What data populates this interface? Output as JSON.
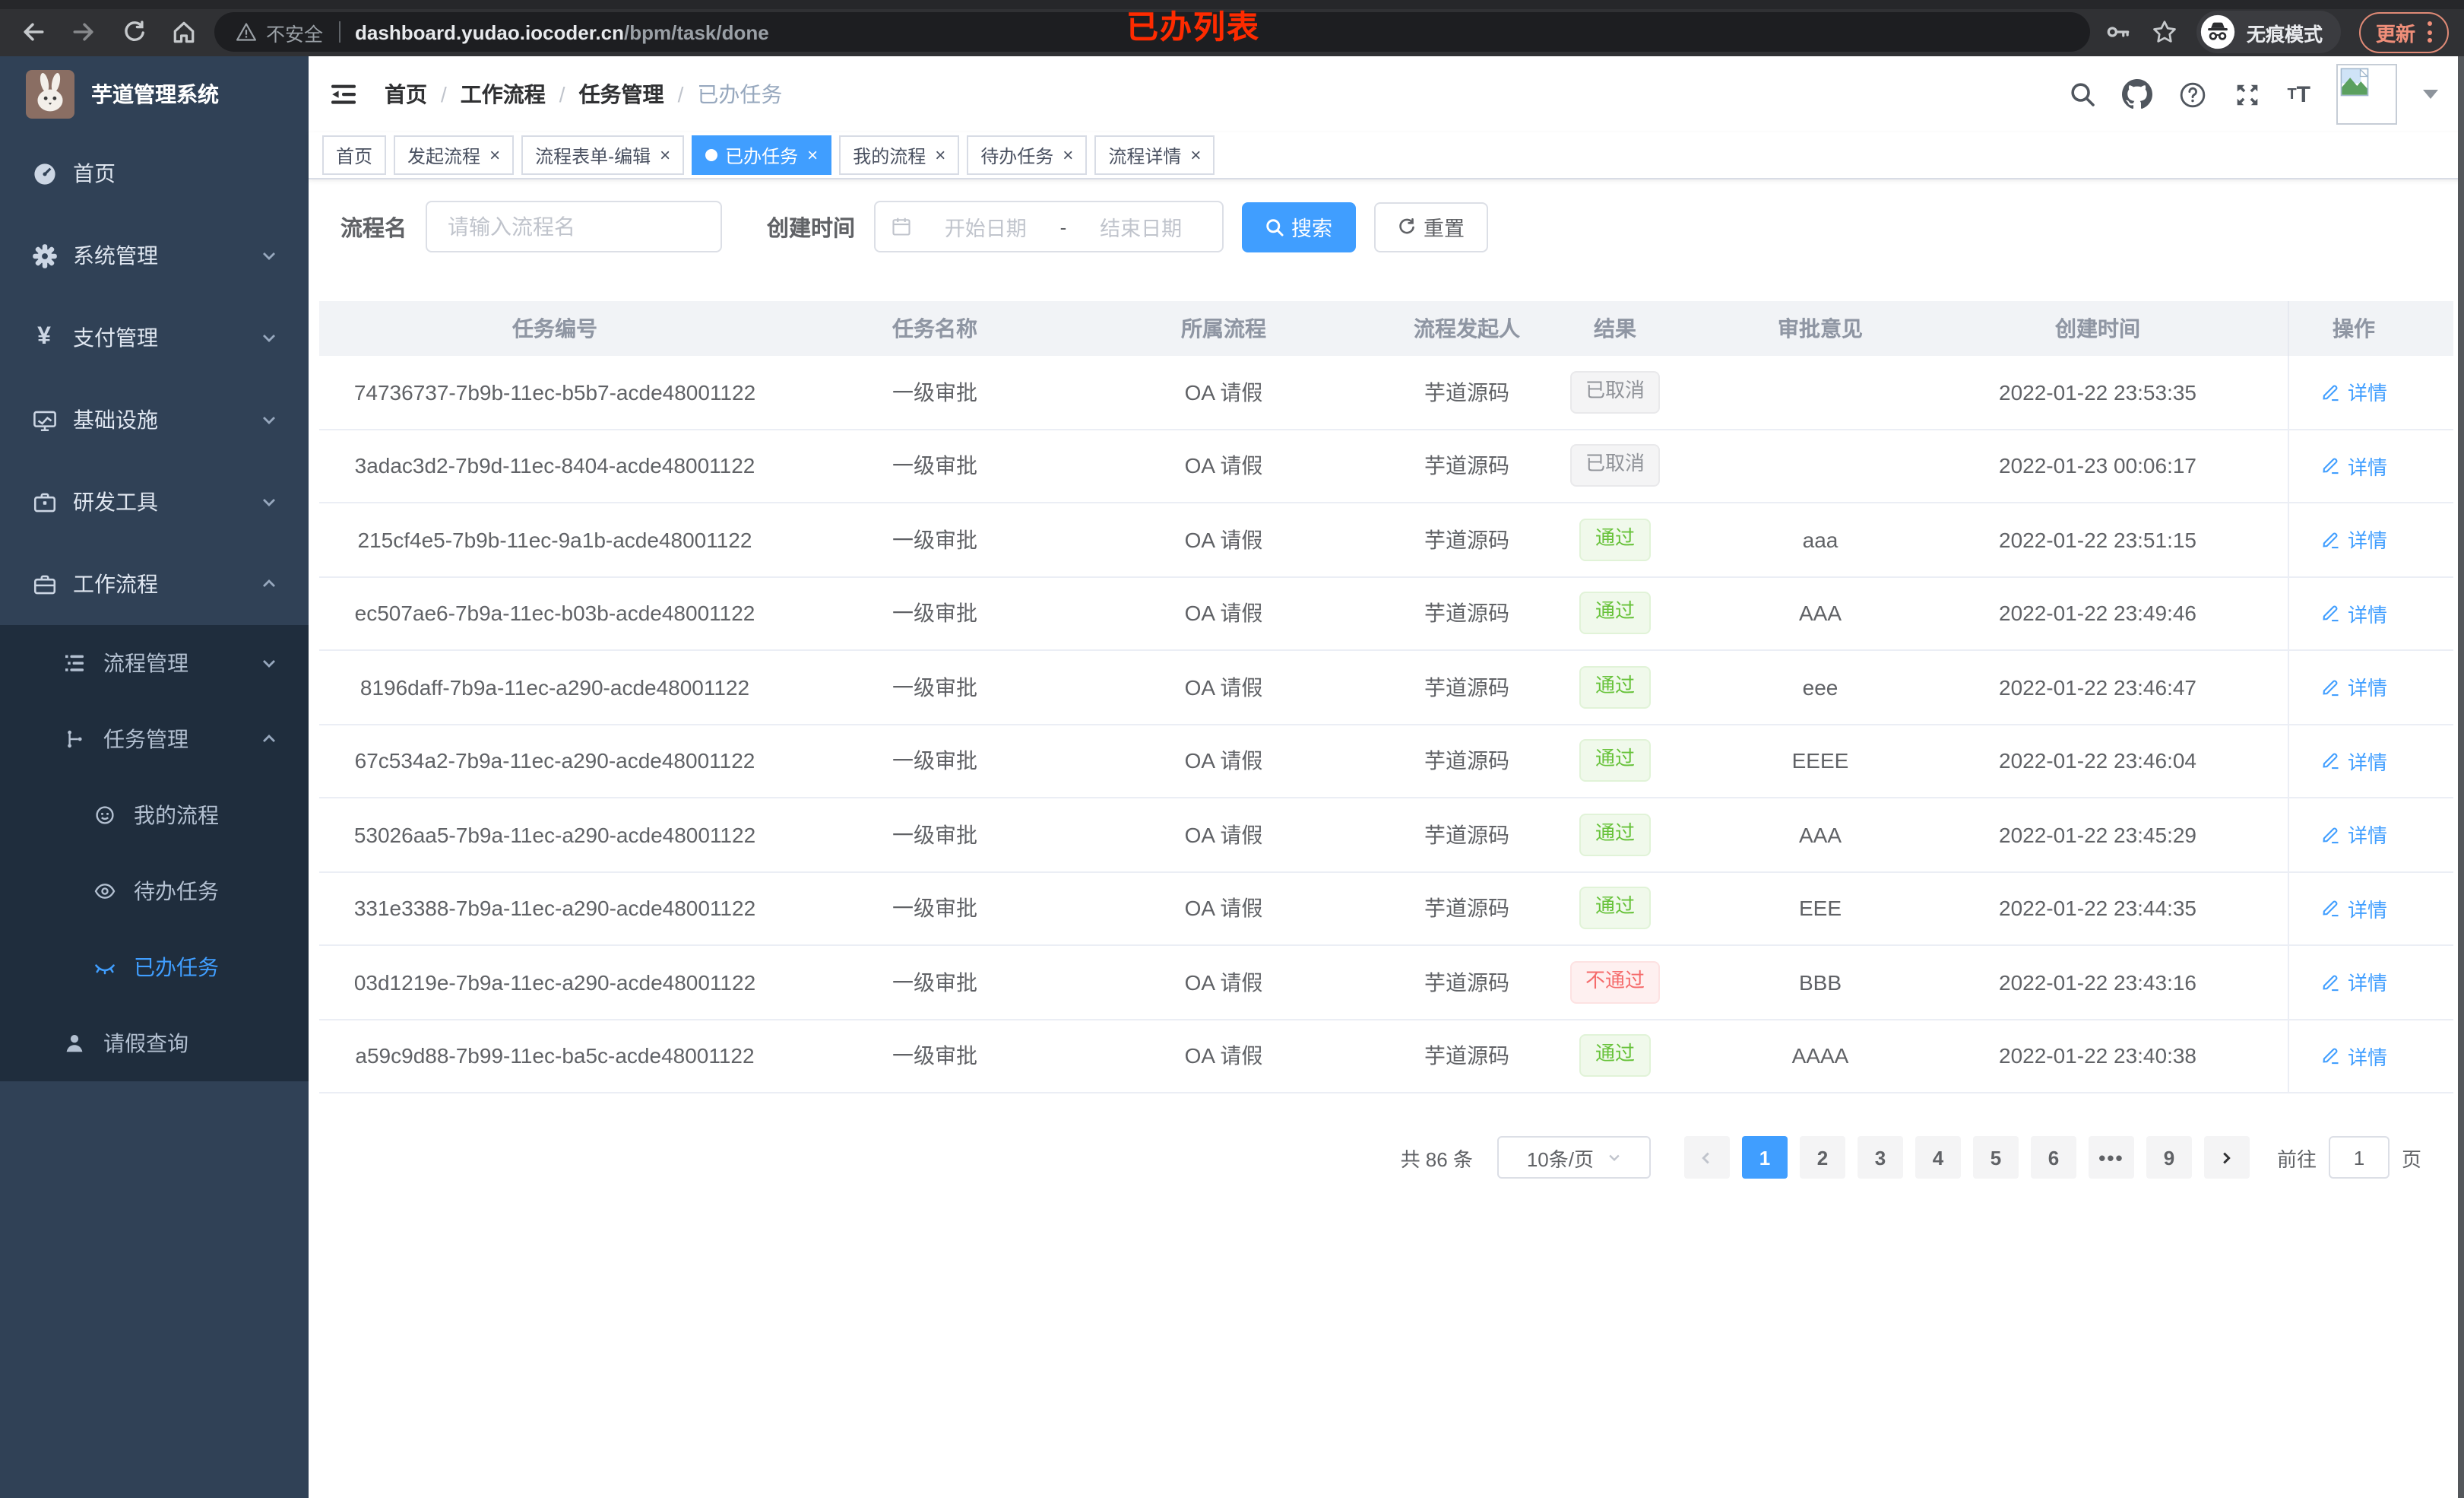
{
  "annotation": "已办列表",
  "browser": {
    "security_label": "不安全",
    "url_host": "dashboard.yudao.iocoder.cn",
    "url_path": "/bpm/task/done",
    "incognito_label": "无痕模式",
    "update_label": "更新"
  },
  "sidebar": {
    "app_title": "芋道管理系统",
    "items": [
      {
        "label": "首页"
      },
      {
        "label": "系统管理"
      },
      {
        "label": "支付管理"
      },
      {
        "label": "基础设施"
      },
      {
        "label": "研发工具"
      },
      {
        "label": "工作流程"
      },
      {
        "label": "流程管理"
      },
      {
        "label": "任务管理"
      },
      {
        "label": "我的流程"
      },
      {
        "label": "待办任务"
      },
      {
        "label": "已办任务"
      },
      {
        "label": "请假查询"
      }
    ]
  },
  "breadcrumb": {
    "separator": "/",
    "items": [
      "首页",
      "工作流程",
      "任务管理",
      "已办任务"
    ]
  },
  "tabs": [
    {
      "label": "首页",
      "closable": false,
      "active": false
    },
    {
      "label": "发起流程",
      "closable": true,
      "active": false
    },
    {
      "label": "流程表单-编辑",
      "closable": true,
      "active": false
    },
    {
      "label": "已办任务",
      "closable": true,
      "active": true
    },
    {
      "label": "我的流程",
      "closable": true,
      "active": false
    },
    {
      "label": "待办任务",
      "closable": true,
      "active": false
    },
    {
      "label": "流程详情",
      "closable": true,
      "active": false
    }
  ],
  "filters": {
    "name_label": "流程名",
    "name_placeholder": "请输入流程名",
    "time_label": "创建时间",
    "start_placeholder": "开始日期",
    "range_separator": "-",
    "end_placeholder": "结束日期",
    "search_label": "搜索",
    "reset_label": "重置"
  },
  "table": {
    "columns": [
      "任务编号",
      "任务名称",
      "所属流程",
      "流程发起人",
      "结果",
      "审批意见",
      "创建时间",
      "操作"
    ],
    "action_label": "详情",
    "rows": [
      {
        "id": "74736737-7b9b-11ec-b5b7-acde48001122",
        "name": "一级审批",
        "process": "OA 请假",
        "starter": "芋道源码",
        "result": "已取消",
        "result_type": "info",
        "opinion": "",
        "time": "2022-01-22 23:53:35"
      },
      {
        "id": "3adac3d2-7b9d-11ec-8404-acde48001122",
        "name": "一级审批",
        "process": "OA 请假",
        "starter": "芋道源码",
        "result": "已取消",
        "result_type": "info",
        "opinion": "",
        "time": "2022-01-23 00:06:17"
      },
      {
        "id": "215cf4e5-7b9b-11ec-9a1b-acde48001122",
        "name": "一级审批",
        "process": "OA 请假",
        "starter": "芋道源码",
        "result": "通过",
        "result_type": "success",
        "opinion": "aaa",
        "time": "2022-01-22 23:51:15"
      },
      {
        "id": "ec507ae6-7b9a-11ec-b03b-acde48001122",
        "name": "一级审批",
        "process": "OA 请假",
        "starter": "芋道源码",
        "result": "通过",
        "result_type": "success",
        "opinion": "AAA",
        "time": "2022-01-22 23:49:46"
      },
      {
        "id": "8196daff-7b9a-11ec-a290-acde48001122",
        "name": "一级审批",
        "process": "OA 请假",
        "starter": "芋道源码",
        "result": "通过",
        "result_type": "success",
        "opinion": "eee",
        "time": "2022-01-22 23:46:47"
      },
      {
        "id": "67c534a2-7b9a-11ec-a290-acde48001122",
        "name": "一级审批",
        "process": "OA 请假",
        "starter": "芋道源码",
        "result": "通过",
        "result_type": "success",
        "opinion": "EEEE",
        "time": "2022-01-22 23:46:04"
      },
      {
        "id": "53026aa5-7b9a-11ec-a290-acde48001122",
        "name": "一级审批",
        "process": "OA 请假",
        "starter": "芋道源码",
        "result": "通过",
        "result_type": "success",
        "opinion": "AAA",
        "time": "2022-01-22 23:45:29"
      },
      {
        "id": "331e3388-7b9a-11ec-a290-acde48001122",
        "name": "一级审批",
        "process": "OA 请假",
        "starter": "芋道源码",
        "result": "通过",
        "result_type": "success",
        "opinion": "EEE",
        "time": "2022-01-22 23:44:35"
      },
      {
        "id": "03d1219e-7b9a-11ec-a290-acde48001122",
        "name": "一级审批",
        "process": "OA 请假",
        "starter": "芋道源码",
        "result": "不通过",
        "result_type": "danger",
        "opinion": "BBB",
        "time": "2022-01-22 23:43:16"
      },
      {
        "id": "a59c9d88-7b99-11ec-ba5c-acde48001122",
        "name": "一级审批",
        "process": "OA 请假",
        "starter": "芋道源码",
        "result": "通过",
        "result_type": "success",
        "opinion": "AAAA",
        "time": "2022-01-22 23:40:38"
      }
    ]
  },
  "pagination": {
    "total_label": "共 86 条",
    "page_size_label": "10条/页",
    "pages": [
      "1",
      "2",
      "3",
      "4",
      "5",
      "6",
      "•••",
      "9"
    ],
    "active_page": "1",
    "goto_label": "前往",
    "goto_value": "1",
    "page_unit": "页"
  },
  "colors": {
    "accent": "#409eff",
    "success": "#67c23a",
    "danger": "#f56c6c",
    "info": "#909399",
    "sidebar_bg": "#304156",
    "submenu_bg": "#1f2d3d",
    "annotation_red": "#fe2b00"
  }
}
